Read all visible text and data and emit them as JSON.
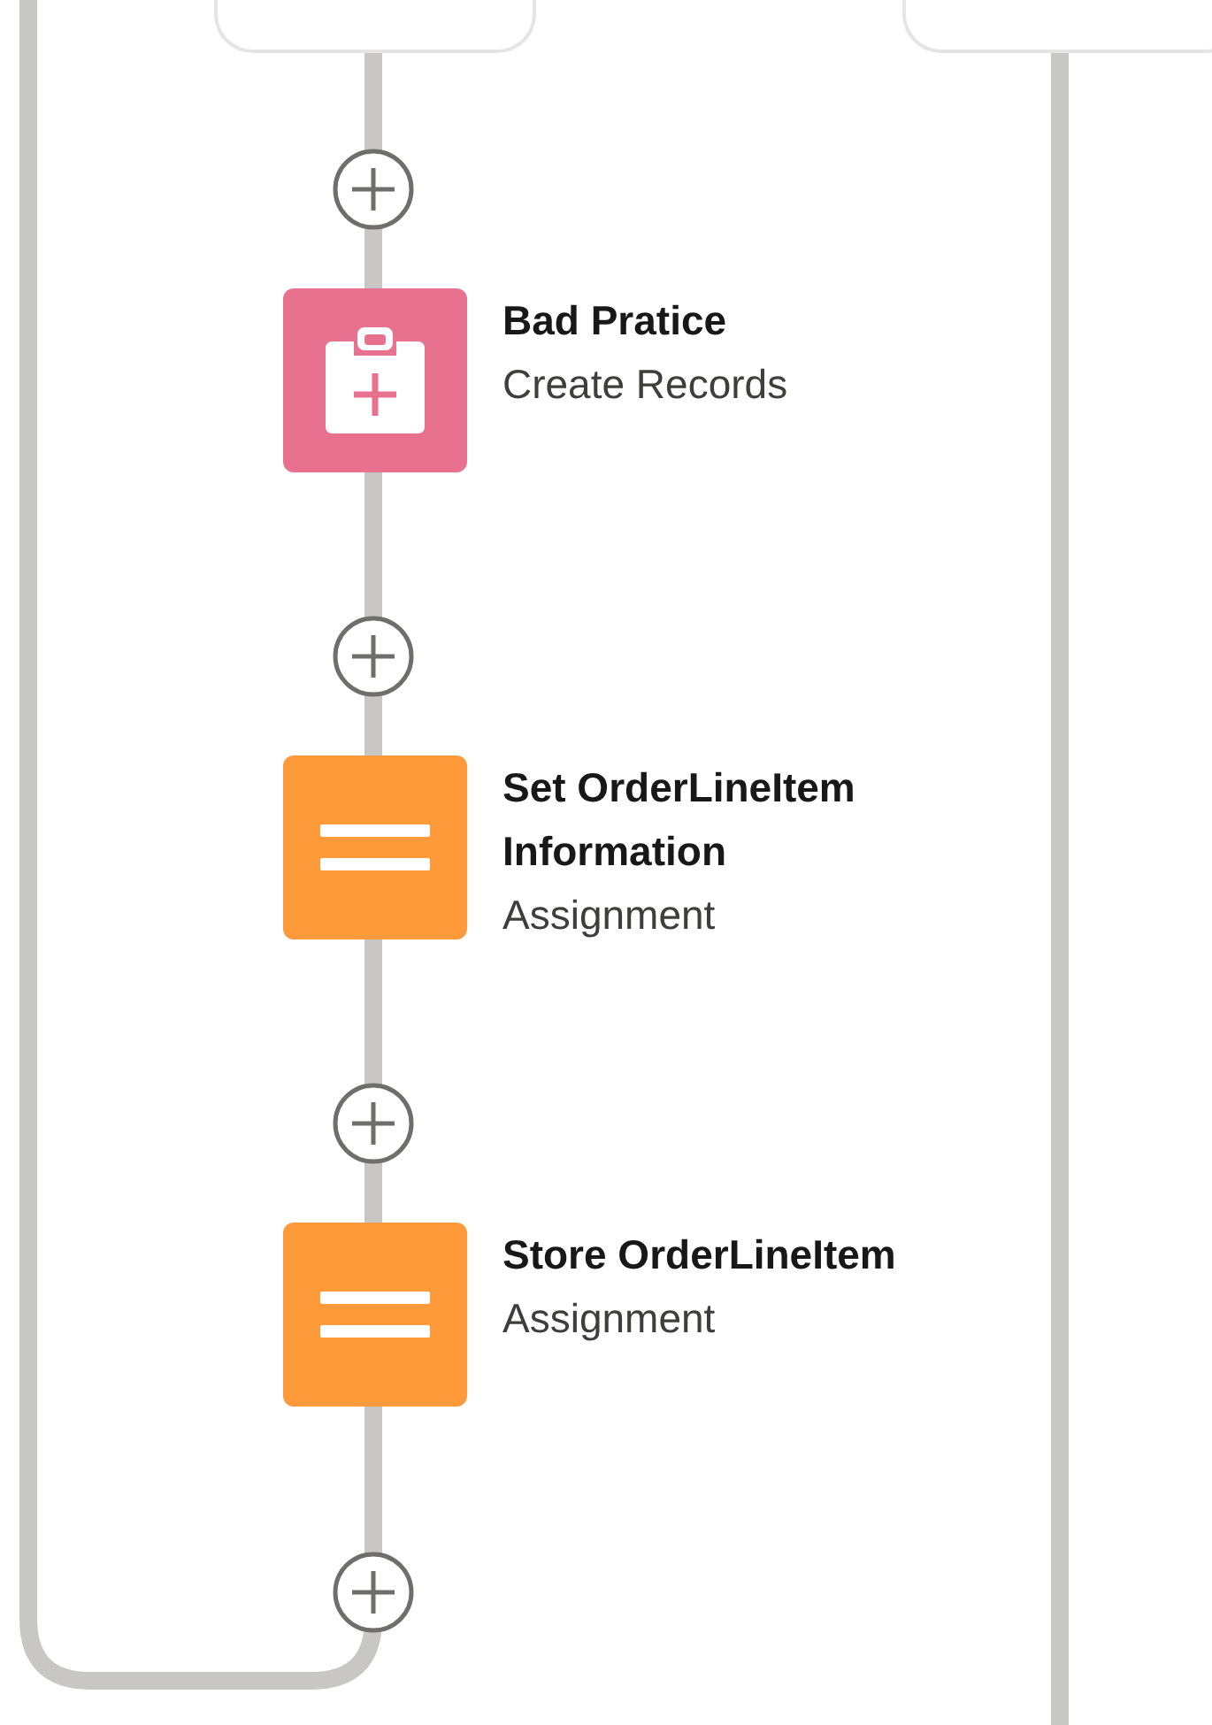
{
  "nodes": [
    {
      "kind": "create_records",
      "title": "Bad Pratice",
      "subtitle": "Create Records"
    },
    {
      "kind": "assignment",
      "title": "Set OrderLineItem Information",
      "subtitle": "Assignment"
    },
    {
      "kind": "assignment",
      "title": "Store OrderLineItem",
      "subtitle": "Assignment"
    }
  ]
}
